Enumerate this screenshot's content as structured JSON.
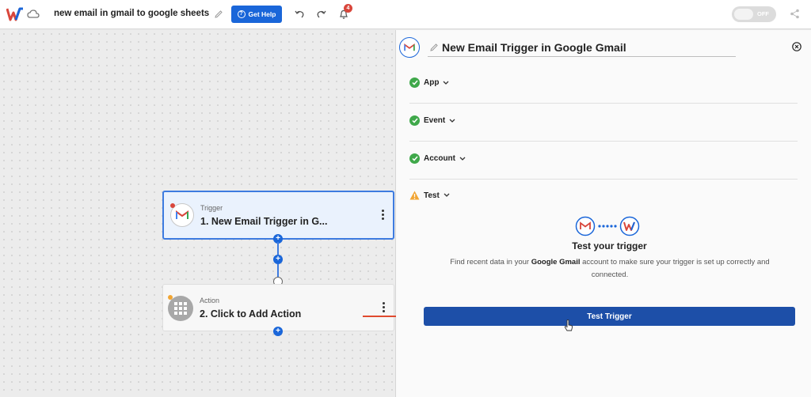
{
  "header": {
    "title": "new email in gmail to google sheets",
    "help_label": "Get Help",
    "notification_count": "4",
    "toggle_label": "OFF"
  },
  "canvas": {
    "trigger": {
      "kind": "Trigger",
      "name": "1. New Email Trigger in G..."
    },
    "action": {
      "kind": "Action",
      "name": "2. Click to Add Action"
    }
  },
  "panel": {
    "title": "New Email Trigger in Google Gmail",
    "sections": [
      {
        "label": "App",
        "status": "complete"
      },
      {
        "label": "Event",
        "status": "complete"
      },
      {
        "label": "Account",
        "status": "complete"
      },
      {
        "label": "Test",
        "status": "warning"
      }
    ],
    "test_heading": "Test your trigger",
    "test_desc_prefix": "Find recent data in your",
    "test_desc_app": "Google Gmail",
    "test_desc_suffix": "account to make sure your trigger is set up correctly and connected.",
    "test_button": "Test Trigger"
  },
  "colors": {
    "accent": "#1a66d9",
    "button": "#1d4fa8",
    "success": "#3fa84a",
    "warning": "#f1a533",
    "arrow": "#e04a2f"
  }
}
